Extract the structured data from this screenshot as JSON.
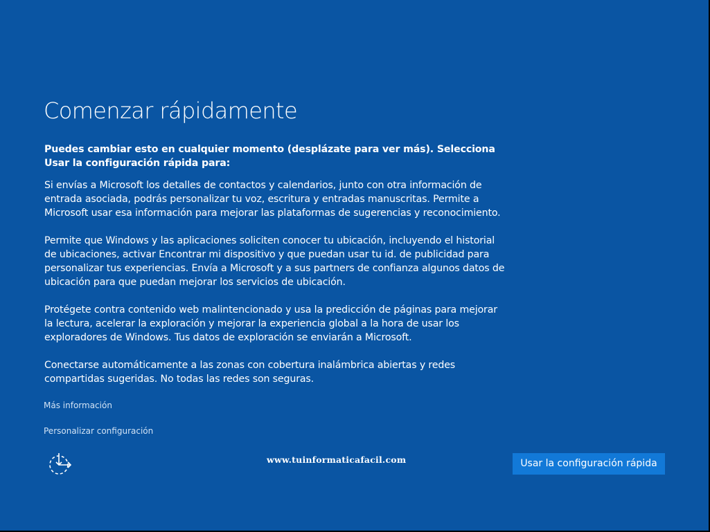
{
  "page": {
    "title": "Comenzar rápidamente",
    "intro": "Puedes cambiar esto en cualquier momento (desplázate para ver más). Selecciona Usar la configuración rápida para:",
    "paragraphs": [
      "Si envías a Microsoft los detalles de contactos y calendarios, junto con otra información de entrada asociada, podrás personalizar tu voz, escritura y entradas manuscritas. Permite a Microsoft usar esa información para mejorar las plataformas de sugerencias y reconocimiento.",
      "Permite que Windows y las aplicaciones soliciten conocer tu ubicación, incluyendo el historial de ubicaciones, activar Encontrar mi dispositivo y que puedan usar tu id. de publicidad para personalizar tus experiencias. Envía a Microsoft y a sus partners de confianza algunos datos de ubicación para que puedan mejorar los servicios de ubicación.",
      "Protégete contra contenido web malintencionado y usa la predicción de páginas para mejorar la lectura, acelerar la exploración y mejorar la experiencia global a la hora de usar los exploradores de Windows. Tus datos de exploración se enviarán a Microsoft.",
      "Conectarse automáticamente a las zonas con cobertura inalámbrica abiertas y redes compartidas sugeridas. No todas las redes son seguras."
    ]
  },
  "links": {
    "more_info": "Más información",
    "customize": "Personalizar configuración"
  },
  "footer": {
    "ease_icon": "ease-of-access-icon",
    "watermark": "www.tuinformaticafacil.com",
    "primary_button": "Usar la configuración rápida"
  },
  "colors": {
    "background": "#0a55a3",
    "button": "#1279d8",
    "link": "#d2e3f5"
  }
}
